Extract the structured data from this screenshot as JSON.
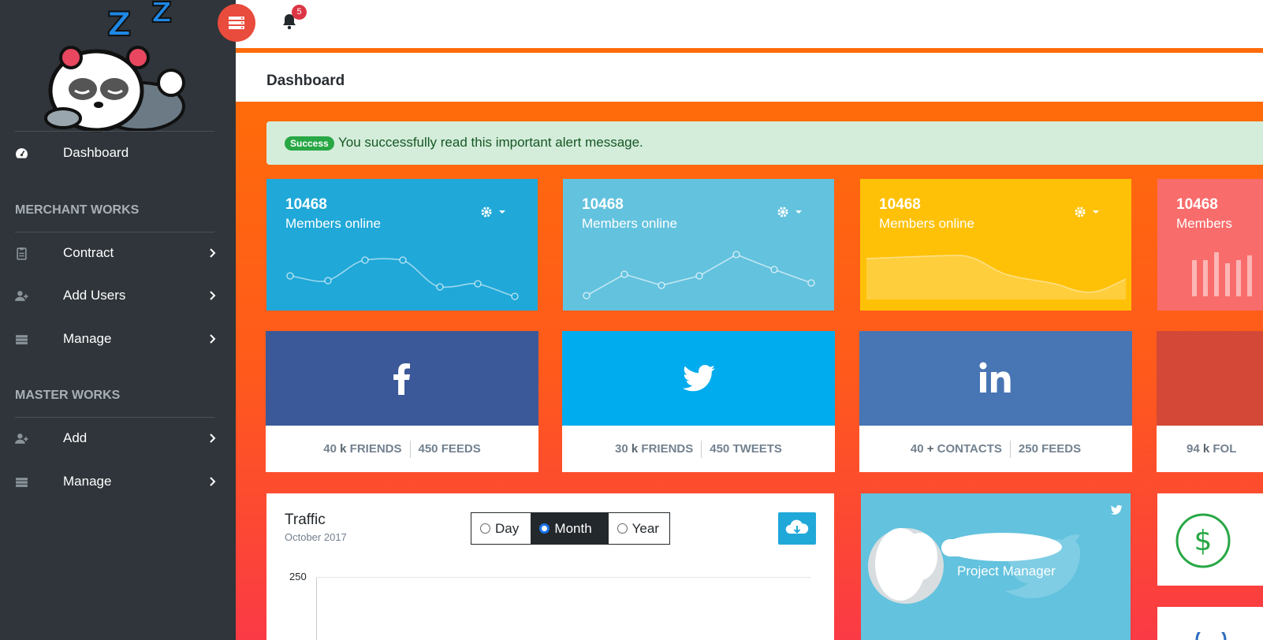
{
  "sidebar": {
    "items": [
      {
        "label": "Dashboard",
        "icon": "dashboard-icon"
      },
      {
        "label": "Contract",
        "icon": "clipboard-icon"
      },
      {
        "label": "Add Users",
        "icon": "user-plus-icon"
      },
      {
        "label": "Manage",
        "icon": "list-icon"
      },
      {
        "label": "Add",
        "icon": "user-plus-icon"
      },
      {
        "label": "Manage",
        "icon": "list-icon"
      }
    ],
    "sections": [
      "MERCHANT WORKS",
      "MASTER WORKS"
    ]
  },
  "header": {
    "notification_count": "5"
  },
  "page": {
    "title": "Dashboard"
  },
  "alert": {
    "badge": "Success",
    "text": "You successfully read this important alert message."
  },
  "stats": [
    {
      "value": "10468",
      "label": "Members online",
      "color": "#20a8d8"
    },
    {
      "value": "10468",
      "label": "Members online",
      "color": "#63c2de"
    },
    {
      "value": "10468",
      "label": "Members online",
      "color": "#ffc107"
    },
    {
      "value": "10468",
      "label": "Members",
      "color": "#f86c6b"
    }
  ],
  "social": [
    {
      "network": "facebook",
      "color": "#3b5998",
      "left": {
        "num": "40",
        "unit": "k",
        "text": "FRIENDS"
      },
      "right": {
        "text": "450 FEEDS"
      }
    },
    {
      "network": "twitter",
      "color": "#00aced",
      "left": {
        "num": "30",
        "unit": "k",
        "text": "FRIENDS"
      },
      "right": {
        "text": "450 TWEETS"
      }
    },
    {
      "network": "linkedin",
      "color": "#4875b4",
      "left": {
        "num": "40",
        "unit": "+",
        "text": "CONTACTS"
      },
      "right": {
        "text": "250 FEEDS"
      }
    },
    {
      "network": "google-plus",
      "color": "#d34836",
      "left": {
        "num": "94",
        "unit": "k",
        "text": "FOL"
      },
      "right": {
        "text": ""
      }
    }
  ],
  "traffic": {
    "title": "Traffic",
    "subtitle": "October 2017",
    "options": [
      "Day",
      "Month",
      "Year"
    ],
    "selected": "Month",
    "y_top_tick": "250"
  },
  "profile_card": {
    "role": "Project Manager"
  }
}
